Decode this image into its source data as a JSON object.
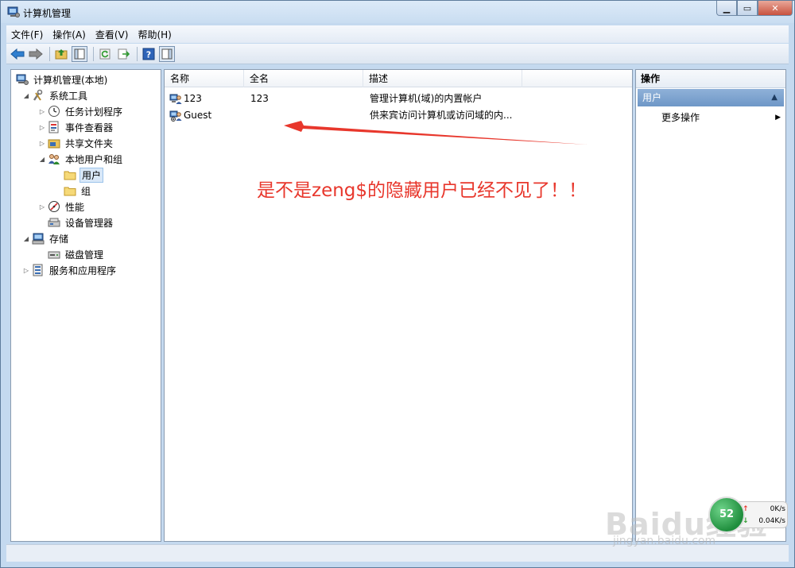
{
  "window": {
    "title": "计算机管理"
  },
  "menu": {
    "items": [
      "文件(F)",
      "操作(A)",
      "查看(V)",
      "帮助(H)"
    ]
  },
  "tree": {
    "items": [
      {
        "label": "计算机管理(本地)",
        "level": 0,
        "expander": "",
        "icon": "computer-management-icon"
      },
      {
        "label": "系统工具",
        "level": 1,
        "expander": "expanded",
        "icon": "system-tools-icon"
      },
      {
        "label": "任务计划程序",
        "level": 2,
        "expander": "collapsed",
        "icon": "task-scheduler-icon"
      },
      {
        "label": "事件查看器",
        "level": 2,
        "expander": "collapsed",
        "icon": "event-viewer-icon"
      },
      {
        "label": "共享文件夹",
        "level": 2,
        "expander": "collapsed",
        "icon": "shared-folders-icon"
      },
      {
        "label": "本地用户和组",
        "level": 2,
        "expander": "expanded",
        "icon": "local-users-groups-icon"
      },
      {
        "label": "用户",
        "level": 3,
        "expander": "",
        "icon": "folder-icon",
        "selected": true
      },
      {
        "label": "组",
        "level": 3,
        "expander": "",
        "icon": "folder-icon"
      },
      {
        "label": "性能",
        "level": 2,
        "expander": "collapsed",
        "icon": "performance-icon"
      },
      {
        "label": "设备管理器",
        "level": 2,
        "expander": "",
        "icon": "device-manager-icon"
      },
      {
        "label": "存储",
        "level": 1,
        "expander": "expanded",
        "icon": "storage-icon"
      },
      {
        "label": "磁盘管理",
        "level": 2,
        "expander": "",
        "icon": "disk-management-icon"
      },
      {
        "label": "服务和应用程序",
        "level": 1,
        "expander": "collapsed",
        "icon": "services-apps-icon"
      }
    ]
  },
  "list": {
    "columns": [
      "名称",
      "全名",
      "描述"
    ],
    "rows": [
      {
        "name": "123",
        "fullname": "123",
        "description": "管理计算机(域)的内置帐户",
        "icon": "user-icon"
      },
      {
        "name": "Guest",
        "fullname": "",
        "description": "供来宾访问计算机或访问域的内...",
        "icon": "guest-user-icon"
      }
    ]
  },
  "annotation": {
    "text": "是不是zeng$的隐藏用户已经不见了！！",
    "color": "#e8372c"
  },
  "actions": {
    "title": "操作",
    "section": "用户",
    "more": "更多操作"
  },
  "watermark": {
    "main": "Baidu经验",
    "sub": "jingyan.baidu.com"
  },
  "network": {
    "upload": "0K/s",
    "download": "0.04K/s",
    "badge": "52"
  }
}
